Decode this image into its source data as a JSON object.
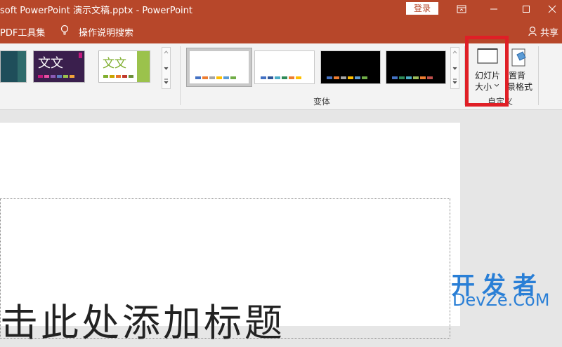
{
  "window": {
    "title": "soft PowerPoint 演示文稿.pptx  -  PowerPoint",
    "login_label": "登录"
  },
  "menubar": {
    "pdf_tools": "PDF工具集",
    "tell_me": "操作说明搜索",
    "share": "共享"
  },
  "ribbon": {
    "themes": [
      {
        "text": "",
        "bg": "#1f4e5a"
      },
      {
        "text": "文文",
        "bg": "#3a1f4d"
      },
      {
        "text": "文文",
        "bg": "#ffffff"
      }
    ],
    "variants": [
      {
        "bg": "#ffffff",
        "selected": true
      },
      {
        "bg": "#ffffff",
        "selected": false
      },
      {
        "bg": "#000000",
        "selected": false
      },
      {
        "bg": "#000000",
        "selected": false
      }
    ],
    "variants_group_label": "变体",
    "slide_size_label_1": "幻灯片",
    "slide_size_label_2": "大小",
    "bg_format_label_1": "置背",
    "bg_format_label_2": "景格式",
    "customize_group_label": "自定义"
  },
  "slide": {
    "title_placeholder": "击此处添加标题"
  },
  "watermark": {
    "top": "开发者",
    "bottom": "DevZe.CoM"
  },
  "colors": {
    "accent": "#b7472a",
    "highlight": "#e01f26"
  }
}
